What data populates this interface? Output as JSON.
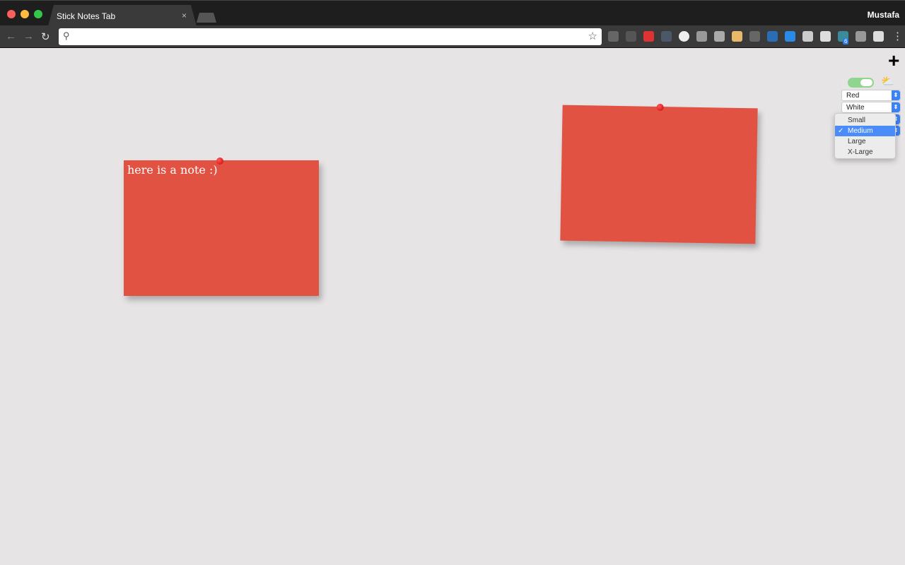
{
  "browser": {
    "tab_title": "Stick Notes Tab",
    "tab_close": "×",
    "user": "Mustafa",
    "url": "",
    "badge_count": "6",
    "extensions": [
      "ublock-icon",
      "cast-icon",
      "red-play-icon",
      "dots-icon",
      "circle-icon",
      "target-icon",
      "react-icon",
      "sticky-icon",
      "chess-icon",
      "code-icon",
      "blue-x-icon",
      "video-icon",
      "image-icon",
      "bookmark-badge-icon",
      "vue-icon",
      "note-icon"
    ]
  },
  "controls": {
    "add_label": "+",
    "toggle_on": true,
    "color_select": "Red",
    "text_color_select": "White",
    "size_options": [
      "Small",
      "Medium",
      "Large",
      "X-Large"
    ],
    "size_selected": "Medium",
    "check": "✓"
  },
  "notes": [
    {
      "text": "here is a note :)",
      "color": "#e25243"
    },
    {
      "text": "",
      "color": "#e25243"
    }
  ]
}
